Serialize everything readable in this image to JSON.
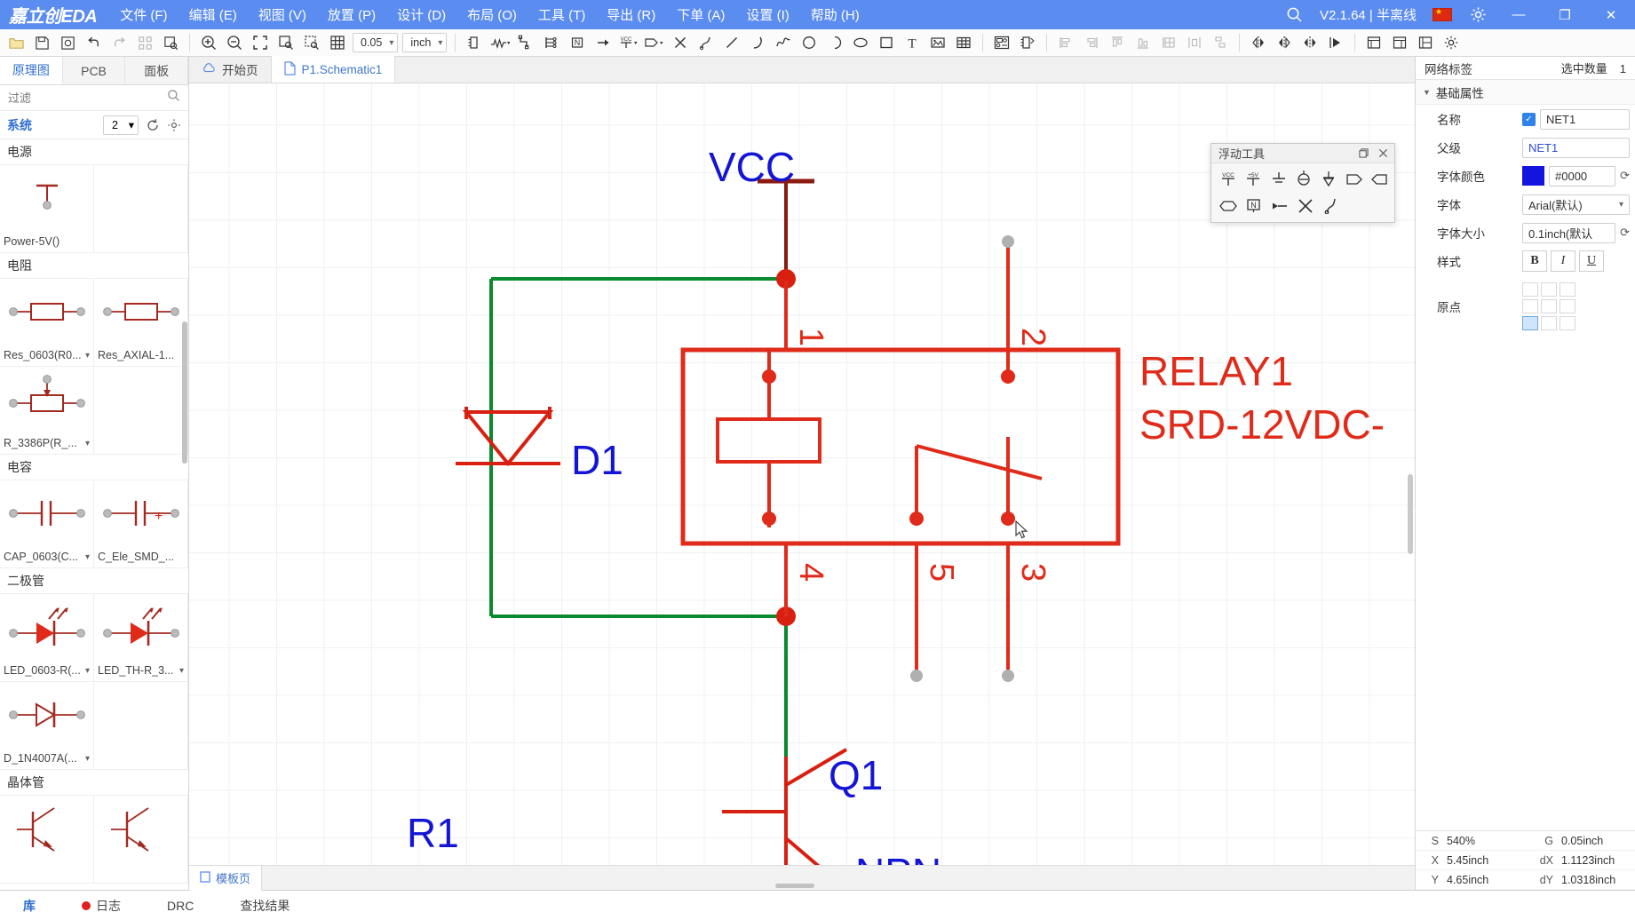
{
  "app": {
    "brand": "嘉立创EDA",
    "version": "V2.1.64 | 半离线",
    "menus": [
      "文件 (F)",
      "编辑 (E)",
      "视图 (V)",
      "放置 (P)",
      "设计 (D)",
      "布局 (O)",
      "工具 (T)",
      "导出 (R)",
      "下单 (A)",
      "设置 (I)",
      "帮助 (H)"
    ],
    "window_buttons": {
      "minimize": "—",
      "maximize": "❐",
      "close": "✕"
    }
  },
  "toolbar": {
    "grid_value": "0.05",
    "unit_value": "inch",
    "icons": [
      "open-folder-icon",
      "save-icon",
      "save-all-icon",
      "undo-icon",
      "redo-icon",
      "panel-icon",
      "print-preview-icon",
      "zoom-in-icon",
      "zoom-out-icon",
      "fit-screen-icon",
      "zoom-area-icon",
      "zoom-select-icon",
      "grid-icon",
      "chip-icon",
      "resistor-icon",
      "wire-icon",
      "bus-icon",
      "netlabel-icon",
      "netflag-icon",
      "vcc-icon",
      "port-icon",
      "no-connect-icon",
      "curve-icon",
      "line-icon",
      "arc-icon",
      "spline-icon",
      "circle-icon",
      "half-circle-icon",
      "ellipse-icon",
      "rectangle-icon",
      "text-icon",
      "image-icon",
      "table-icon",
      "footprint-manager-icon",
      "package-icon",
      "align-left-icon",
      "align-right-icon",
      "align-top-icon",
      "align-bottom-icon",
      "align-center-grid-icon",
      "distribute-h-icon",
      "distribute-v-icon",
      "mirror-v-icon",
      "mirror-h-icon",
      "flip-icon",
      "rotate-icon",
      "layers-icon",
      "board-icon",
      "settings-panel-icon",
      "gear2-icon"
    ]
  },
  "left_panel": {
    "tabs": [
      {
        "label": "原理图",
        "active": true
      },
      {
        "label": "PCB",
        "active": false
      },
      {
        "label": "面板",
        "active": false
      }
    ],
    "filter_placeholder": "过滤",
    "system_label": "系统",
    "system_count": "2",
    "categories": [
      {
        "name": "电源",
        "items": [
          {
            "name": "Power-5V()",
            "icon": "power-5v-symbol",
            "has_dropdown": false
          }
        ]
      },
      {
        "name": "电阻",
        "items": [
          {
            "name": "Res_0603(R0...",
            "icon": "resistor-symbol",
            "has_dropdown": true
          },
          {
            "name": "Res_AXIAL-1...",
            "icon": "resistor-symbol",
            "has_dropdown": true
          },
          {
            "name": "R_3386P(R_...",
            "icon": "potentiometer-symbol",
            "has_dropdown": true
          }
        ]
      },
      {
        "name": "电容",
        "items": [
          {
            "name": "CAP_0603(C...",
            "icon": "capacitor-symbol",
            "has_dropdown": true
          },
          {
            "name": "C_Ele_SMD_...",
            "icon": "polar-capacitor-symbol",
            "has_dropdown": true
          }
        ]
      },
      {
        "name": "二极管",
        "items": [
          {
            "name": "LED_0603-R(...",
            "icon": "led-symbol",
            "has_dropdown": true
          },
          {
            "name": "LED_TH-R_3...",
            "icon": "led-symbol",
            "has_dropdown": true
          },
          {
            "name": "D_1N4007A(...",
            "icon": "diode-symbol",
            "has_dropdown": true
          }
        ]
      },
      {
        "name": "晶体管",
        "items": [
          {
            "name": "",
            "icon": "transistor-symbol",
            "has_dropdown": false
          },
          {
            "name": "",
            "icon": "transistor-symbol",
            "has_dropdown": false
          }
        ]
      }
    ]
  },
  "doc_tabs": [
    {
      "label": "开始页",
      "icon": "cloud-icon",
      "active": false
    },
    {
      "label": "P1.Schematic1",
      "icon": "file-icon",
      "active": true
    }
  ],
  "sheet_tab": {
    "label": "模板页",
    "icon": "sheet-icon"
  },
  "floating_tools": {
    "title": "浮动工具",
    "maximize_icon": "restore-icon",
    "close_icon": "close-icon",
    "row1": [
      "vcc-flag-icon",
      "plus5v-flag-icon",
      "ground-icon",
      "earth-ground-icon",
      "chassis-ground-icon",
      "port-right-icon",
      "port-left-icon"
    ],
    "row2": [
      "netport-icon",
      "netlabel-n-icon",
      "pin-icon",
      "no-connect-icon",
      "probe-icon"
    ]
  },
  "schematic": {
    "labels": [
      {
        "text": "VCC",
        "color": "#1414d6"
      },
      {
        "text": "D1",
        "color": "#1414d6"
      },
      {
        "text": "Q1",
        "color": "#1414d6"
      },
      {
        "text": "R1",
        "color": "#1414d6"
      },
      {
        "text": "NPN",
        "color": "#1414d6"
      },
      {
        "text": "RELAY1",
        "color": "#e02b1a"
      },
      {
        "text": "SRD-12VDC-",
        "color": "#e02b1a"
      }
    ],
    "pin_numbers": [
      "1",
      "2",
      "4",
      "5",
      "3"
    ],
    "wire_color": "#0a8a2e",
    "component_color": "#e02b1a"
  },
  "right_panel": {
    "title": "网络标签",
    "selected_count_label": "选中数量",
    "selected_count": "1",
    "section": "基础属性",
    "fields": [
      {
        "label": "名称",
        "value": "NET1",
        "checked": true,
        "type": "checkbox-text"
      },
      {
        "label": "父级",
        "value": "NET1",
        "type": "text-blue"
      },
      {
        "label": "字体颜色",
        "value": "#0000",
        "swatch": "#1414e0",
        "type": "color"
      },
      {
        "label": "字体",
        "value": "Arial(默认)",
        "type": "select"
      },
      {
        "label": "字体大小",
        "value": "0.1inch(默认",
        "type": "text-refresh"
      },
      {
        "label": "样式",
        "value": "",
        "type": "style",
        "buttons": [
          "B",
          "I",
          "U"
        ]
      },
      {
        "label": "原点",
        "value": "",
        "type": "origin"
      }
    ],
    "status": [
      {
        "k": "S",
        "v": "540%",
        "k2": "G",
        "v2": "0.05inch"
      },
      {
        "k": "X",
        "v": "5.45inch",
        "k2": "dX",
        "v2": "1.1123inch"
      },
      {
        "k": "Y",
        "v": "4.65inch",
        "k2": "dY",
        "v2": "1.0318inch"
      }
    ]
  },
  "bottom_bar": {
    "tabs": [
      {
        "label": "库",
        "active": true,
        "dot": false
      },
      {
        "label": "日志",
        "active": false,
        "dot": true
      },
      {
        "label": "DRC",
        "active": false,
        "dot": false
      },
      {
        "label": "查找结果",
        "active": false,
        "dot": false
      }
    ]
  }
}
